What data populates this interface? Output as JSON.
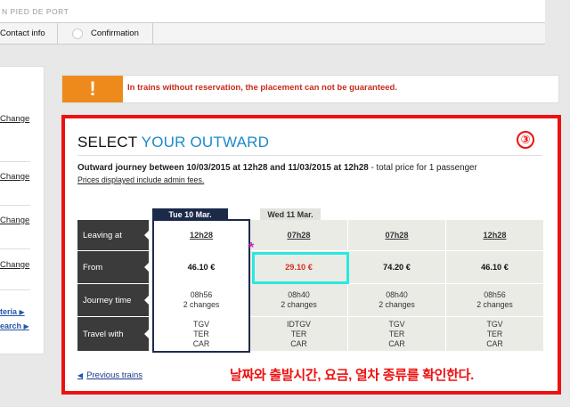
{
  "topbar": {
    "text": "N PIED DE PORT"
  },
  "steps": {
    "contact": "Contact info",
    "confirmation": "Confirmation"
  },
  "left_panel": {
    "change_links": [
      "Change",
      "Change",
      "Change",
      "Change"
    ],
    "criteria_link": "teria",
    "search_link": "earch"
  },
  "warning": {
    "icon": "!",
    "text": "In trains without reservation, the placement can not be guaranteed."
  },
  "main": {
    "title_plain": "SELECT",
    "title_accent": "YOUR OUTWARD",
    "step_number": "③",
    "journey_prefix": "Outward journey between ",
    "journey_start": "10/03/2015 at 12h28",
    "journey_mid": " and ",
    "journey_end": "11/03/2015 at 12h28",
    "journey_suffix": " - total price for 1 passenger",
    "prices_note": "Prices displayed include admin fees.",
    "date_tabs": [
      "Tue 10 Mar.",
      "Wed 11 Mar."
    ],
    "row_labels": [
      "Leaving at",
      "From",
      "Journey time",
      "Travel with"
    ],
    "options": [
      {
        "leaving": "12h28",
        "price": "46.10 €",
        "duration": "08h56",
        "changes": "2 changes",
        "trains": [
          "TGV",
          "TER",
          "CAR"
        ]
      },
      {
        "leaving": "07h28",
        "price": "29.10 €",
        "duration": "08h40",
        "changes": "2 changes",
        "trains": [
          "IDTGV",
          "TER",
          "CAR"
        ]
      },
      {
        "leaving": "07h28",
        "price": "74.20 €",
        "duration": "08h40",
        "changes": "2 changes",
        "trains": [
          "TGV",
          "TER",
          "CAR"
        ]
      },
      {
        "leaving": "12h28",
        "price": "46.10 €",
        "duration": "08h56",
        "changes": "2 changes",
        "trains": [
          "TGV",
          "TER",
          "CAR"
        ]
      }
    ],
    "previous_trains": "Previous trains",
    "annotation": "날짜와 출발시간, 요금, 열차 종류를 확인한다."
  },
  "colors": {
    "accent_blue": "#1a8ac9",
    "warning_orange": "#ee8a1c",
    "highlight_red": "#ee1111",
    "highlight_cyan": "#2be8e0",
    "selected_navy": "#1c2a4a"
  }
}
